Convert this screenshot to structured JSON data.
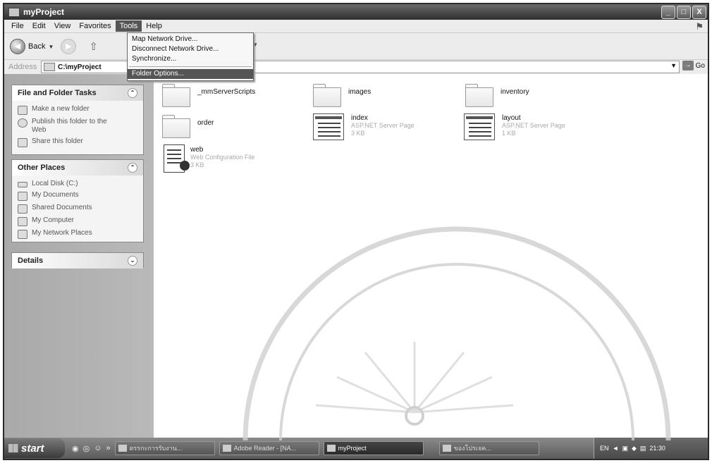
{
  "window": {
    "title": "myProject",
    "min": "_",
    "max": "□",
    "close": "X"
  },
  "menubar": [
    "File",
    "Edit",
    "View",
    "Favorites",
    "Tools",
    "Help"
  ],
  "toolbar": {
    "back_label": "Back"
  },
  "address": {
    "label": "Address",
    "value": "C:\\myProject",
    "go_label": "Go"
  },
  "tools_menu": {
    "items": [
      "Map Network Drive...",
      "Disconnect Network Drive...",
      "Synchronize..."
    ],
    "selected_item": "Folder Options..."
  },
  "panels": {
    "file_tasks": {
      "title": "File and Folder Tasks",
      "items": [
        "Make a new folder",
        "Publish this folder to the Web",
        "Share this folder"
      ]
    },
    "other_places": {
      "title": "Other Places",
      "items": [
        "Local Disk (C:)",
        "My Documents",
        "Shared Documents",
        "My Computer",
        "My Network Places"
      ]
    },
    "details": {
      "title": "Details"
    }
  },
  "files": [
    {
      "name": "_mmServerScripts",
      "type": "",
      "size": ""
    },
    {
      "name": "images",
      "type": "",
      "size": ""
    },
    {
      "name": "inventory",
      "type": "",
      "size": ""
    },
    {
      "name": "order",
      "type": "",
      "size": ""
    },
    {
      "name": "index",
      "type": "ASP.NET Server Page",
      "size": "3 KB"
    },
    {
      "name": "layout",
      "type": "ASP.NET Server Page",
      "size": "1 KB"
    },
    {
      "name": "web",
      "type": "Web Configuration File",
      "size": "3 KB"
    }
  ],
  "taskbar": {
    "start": "start",
    "buttons": [
      "ตรรกะการรับงาน...",
      "Adobe Reader - [NA...",
      "myProject",
      "ของโปรเจค..."
    ],
    "clock": "21:30",
    "lang": "EN"
  },
  "colors": {
    "title_bar": "#2f2f2f",
    "selection": "#555555",
    "pane": "#b0b0b0"
  }
}
